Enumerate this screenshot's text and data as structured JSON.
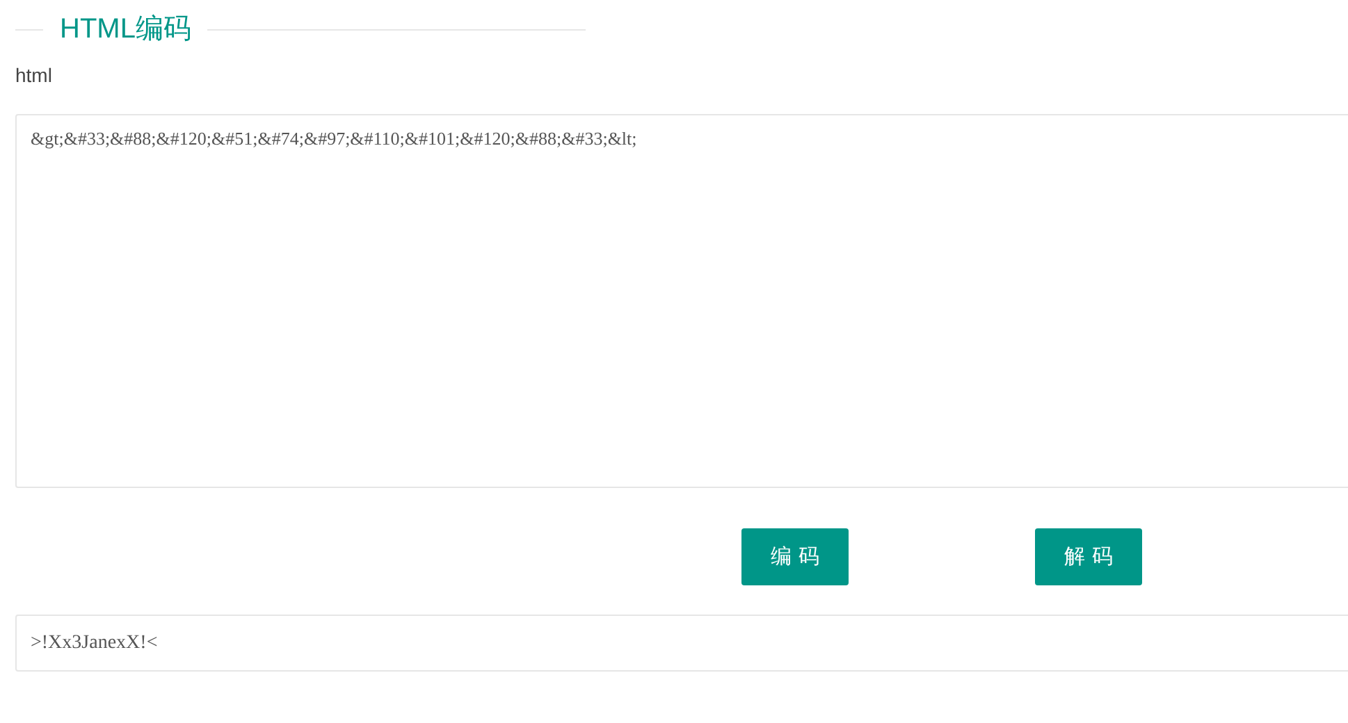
{
  "section": {
    "title": "HTML编码"
  },
  "input_label": "html",
  "input": {
    "value": "&gt;&#33;&#88;&#120;&#51;&#74;&#97;&#110;&#101;&#120;&#88;&#33;&lt;"
  },
  "buttons": [
    {
      "label": "编 码"
    },
    {
      "label": "解 码"
    }
  ],
  "output": {
    "value": ">!Xx3JanexX!<"
  }
}
